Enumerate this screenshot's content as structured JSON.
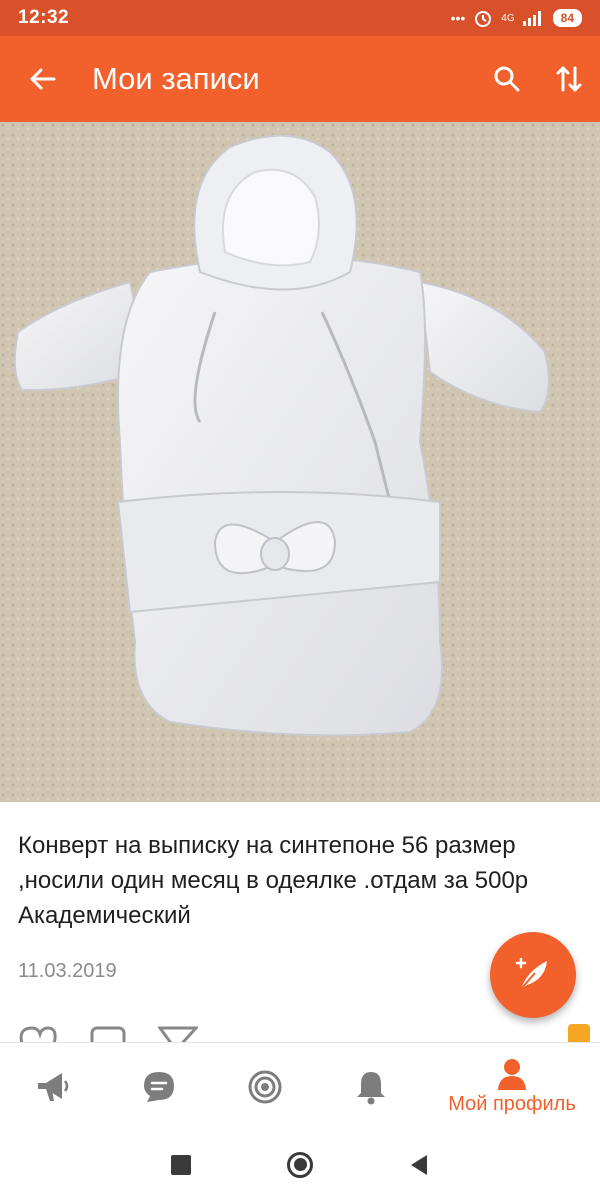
{
  "status_bar": {
    "time": "12:32",
    "dots": "•••",
    "network": "4G",
    "battery": "84"
  },
  "app_bar": {
    "title": "Мои записи",
    "icons": [
      "back-arrow-icon",
      "search-icon",
      "sort-icon"
    ]
  },
  "post": {
    "text": "Конверт на выписку на синтепоне 56 размер ,носили один месяц в одеялке .отдам за 500р Академический",
    "date": "11.03.2019",
    "photo_icon": "baby-snowsuit-photo"
  },
  "fab": {
    "icon": "new-post-feather-icon"
  },
  "reactions": {
    "icons": [
      "like-icon",
      "comment-icon",
      "share-icon"
    ]
  },
  "bottom_nav": {
    "items": [
      {
        "icon": "megaphone-icon"
      },
      {
        "icon": "messages-icon"
      },
      {
        "icon": "discussions-icon"
      },
      {
        "icon": "bell-icon"
      },
      {
        "icon": "profile-icon",
        "label": "Мой профиль"
      }
    ],
    "accent": "#f2602b"
  },
  "system_nav": {
    "icons": [
      "recents-square-icon",
      "home-circle-icon",
      "back-triangle-icon"
    ]
  },
  "colors": {
    "status_bar": "#d9512a",
    "app_bar": "#f2602b",
    "carpet": "#cfc5b1",
    "text": "#1f1f1f",
    "date": "#8a8a8a"
  }
}
